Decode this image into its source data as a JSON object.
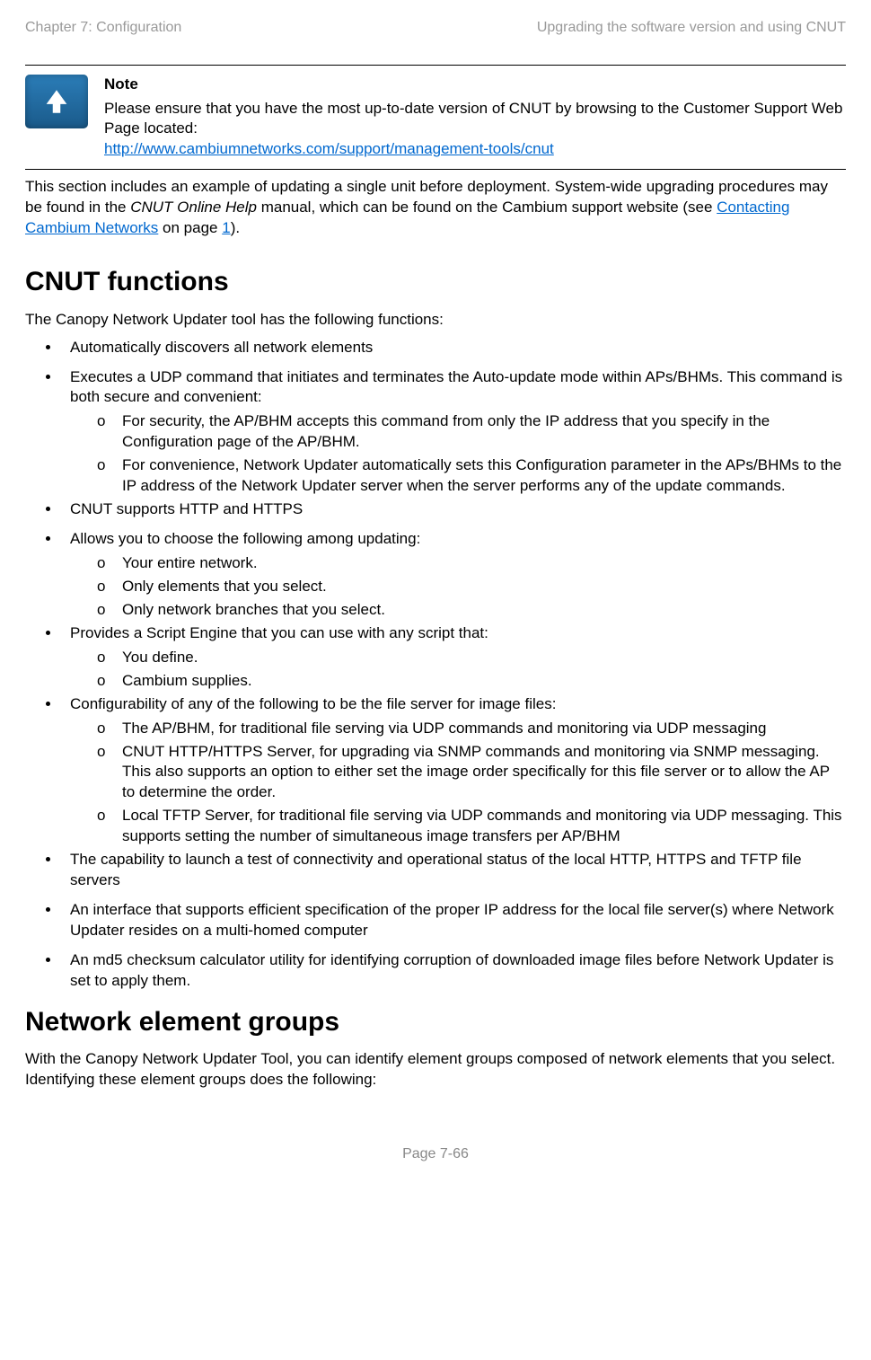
{
  "header": {
    "left": "Chapter 7:  Configuration",
    "right": "Upgrading the software version and using CNUT"
  },
  "note": {
    "title": "Note",
    "line1": "Please ensure that you have the most up-to-date version of CNUT by browsing to the Customer Support Web Page located:",
    "link": "http://www.cambiumnetworks.com/support/management-tools/cnut"
  },
  "intro": {
    "part1": "This section includes an example of updating a single unit before deployment. System-wide upgrading procedures may be found in the ",
    "italic": "CNUT Online Help",
    "part2": " manual, which can be found on the Cambium support website (see ",
    "link": "Contacting Cambium Networks",
    "part3": " on page ",
    "pageref": "1",
    "part4": ")."
  },
  "sections": {
    "cnut_title": "CNUT functions",
    "cnut_intro": "The Canopy Network Updater tool has the following functions:",
    "neg_title": "Network element groups",
    "neg_intro": "With the Canopy Network Updater Tool, you can identify element groups composed of network elements that you select. Identifying these element groups does the following:"
  },
  "bullets": {
    "b1": "Automatically discovers all network elements",
    "b2": "Executes a UDP command that initiates and terminates the Auto-update mode within APs/BHMs. This command is both secure and convenient:",
    "b2_sub1": "For security, the AP/BHM accepts this command from only the IP address that you specify in the Configuration page of the AP/BHM.",
    "b2_sub2": "For convenience, Network Updater automatically sets this Configuration parameter in the APs/BHMs to the IP address of the Network Updater server when the server performs any of the update commands.",
    "b3": "CNUT supports HTTP and HTTPS",
    "b4": "Allows you to choose the following among updating:",
    "b4_sub1": "Your entire network.",
    "b4_sub2": "Only elements that you select.",
    "b4_sub3": "Only network branches that you select.",
    "b5": "Provides a Script Engine that you can use with any script that:",
    "b5_sub1": "You define.",
    "b5_sub2": "Cambium supplies.",
    "b6": "Configurability of any of the following to be the file server for image files:",
    "b6_sub1": "The AP/BHM, for traditional file serving via UDP commands and monitoring via UDP messaging",
    "b6_sub2": "CNUT HTTP/HTTPS Server, for upgrading via SNMP commands and monitoring via SNMP messaging. This also supports an option to either set the image order specifically for this file server or to allow the AP to determine the order.",
    "b6_sub3": "Local TFTP Server, for traditional file serving via UDP commands and monitoring via UDP messaging. This supports setting the number of simultaneous image transfers per AP/BHM",
    "b7": "The capability to launch a test of connectivity and operational status of the local HTTP, HTTPS and TFTP file servers",
    "b8": "An interface that supports efficient specification of the proper IP address for the local file server(s) where Network Updater resides on a multi-homed computer",
    "b9": "An md5 checksum calculator utility for identifying corruption of downloaded image files before Network Updater is set to apply them."
  },
  "footer": {
    "page": "Page 7-66"
  }
}
